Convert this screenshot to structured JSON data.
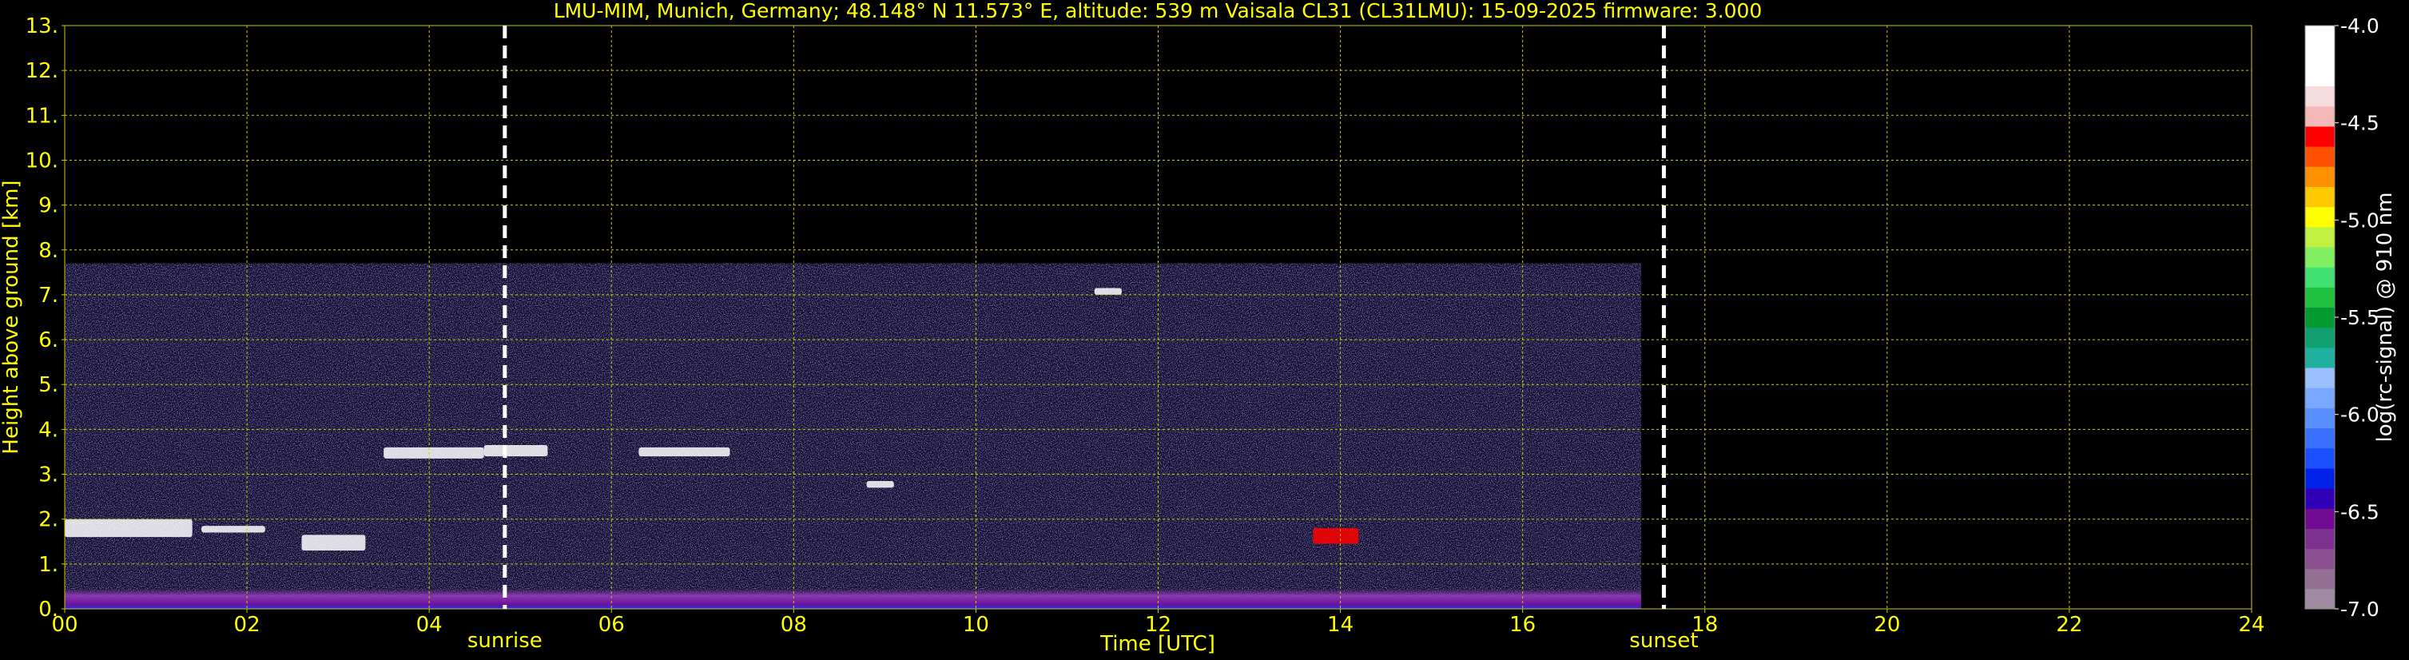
{
  "chart_data": {
    "type": "heatmap",
    "title": "LMU-MIM, Munich, Germany; 48.148° N 11.573° E, altitude: 539 m    Vaisala CL31 (CL31LMU): 15-09-2025    firmware: 3.000",
    "xlabel": "Time [UTC]",
    "ylabel": "Height above ground [km]",
    "xlim": [
      0,
      24
    ],
    "ylim": [
      0,
      13
    ],
    "x_ticks": [
      "00",
      "02",
      "04",
      "06",
      "08",
      "10",
      "12",
      "14",
      "16",
      "18",
      "20",
      "22",
      "24"
    ],
    "y_ticks": [
      "0.",
      "1.",
      "2.",
      "3.",
      "4.",
      "5.",
      "6.",
      "7.",
      "8.",
      "9.",
      "10.",
      "11.",
      "12.",
      "13."
    ],
    "grid": true,
    "data_extent": {
      "time_end_h": 17.3,
      "max_height_km": 7.7
    },
    "markers": [
      {
        "label": "sunrise",
        "time_h": 4.83
      },
      {
        "label": "sunset",
        "time_h": 17.55
      }
    ],
    "colorbar": {
      "label": "log(rc-signal) @ 910 nm",
      "range": [
        -7.0,
        -4.0
      ],
      "ticks": [
        "-4.0",
        "-4.5",
        "-5.0",
        "-5.5",
        "-6.0",
        "-6.5",
        "-7.0"
      ],
      "colors": [
        "#a08aa0",
        "#947094",
        "#8a5090",
        "#7d3090",
        "#700a90",
        "#3000b8",
        "#0022e8",
        "#1a50ff",
        "#3a70ff",
        "#5a90ff",
        "#7aa8ff",
        "#9cc0ff",
        "#20b0a0",
        "#10a070",
        "#009a30",
        "#20c040",
        "#40e070",
        "#80f060",
        "#c0f040",
        "#ffff00",
        "#ffc800",
        "#ff9000",
        "#ff5000",
        "#ff0000",
        "#f4b8b8",
        "#f4dcdc",
        "#ffffff",
        "#ffffff",
        "#ffffff"
      ]
    },
    "features": [
      {
        "name": "surface aerosol layer",
        "t0": 0.0,
        "t1": 17.3,
        "h0": 0.0,
        "h1": 0.45,
        "level": -6.4
      },
      {
        "name": "low cloud",
        "t0": 0.0,
        "t1": 1.4,
        "h0": 1.6,
        "h1": 2.0,
        "level": -4.2
      },
      {
        "name": "cloud",
        "t0": 1.5,
        "t1": 2.2,
        "h0": 1.7,
        "h1": 1.85,
        "level": -4.2
      },
      {
        "name": "cloud",
        "t0": 2.6,
        "t1": 3.3,
        "h0": 1.3,
        "h1": 1.65,
        "level": -4.2
      },
      {
        "name": "cloud",
        "t0": 3.5,
        "t1": 4.6,
        "h0": 3.35,
        "h1": 3.6,
        "level": -4.2
      },
      {
        "name": "cloud",
        "t0": 4.6,
        "t1": 5.3,
        "h0": 3.4,
        "h1": 3.65,
        "level": -4.2
      },
      {
        "name": "cloud",
        "t0": 6.3,
        "t1": 7.3,
        "h0": 3.4,
        "h1": 3.6,
        "level": -4.2
      },
      {
        "name": "cloud",
        "t0": 8.8,
        "t1": 9.1,
        "h0": 2.7,
        "h1": 2.85,
        "level": -4.2
      },
      {
        "name": "cloud",
        "t0": 11.3,
        "t1": 11.6,
        "h0": 7.0,
        "h1": 7.15,
        "level": -4.2
      },
      {
        "name": "cloud",
        "t0": 13.7,
        "t1": 14.2,
        "h0": 1.45,
        "h1": 1.8,
        "level": -4.6
      }
    ]
  }
}
